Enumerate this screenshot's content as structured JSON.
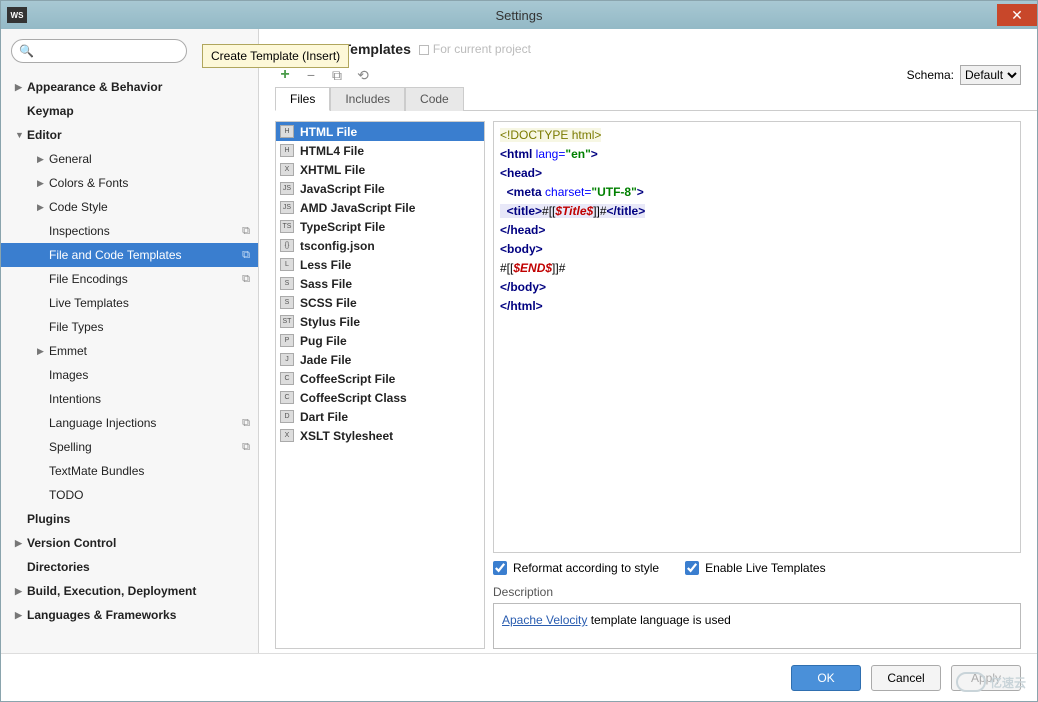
{
  "window": {
    "title": "Settings",
    "app_icon_text": "WS"
  },
  "tooltip": "Create Template (Insert)",
  "search": {
    "placeholder": ""
  },
  "tree": [
    {
      "label": "Appearance & Behavior",
      "level": 1,
      "bold": true,
      "arrow": "▶"
    },
    {
      "label": "Keymap",
      "level": 1,
      "bold": true,
      "arrow": ""
    },
    {
      "label": "Editor",
      "level": 1,
      "bold": true,
      "arrow": "▼"
    },
    {
      "label": "General",
      "level": 2,
      "bold": false,
      "arrow": "▶"
    },
    {
      "label": "Colors & Fonts",
      "level": 2,
      "bold": false,
      "arrow": "▶"
    },
    {
      "label": "Code Style",
      "level": 2,
      "bold": false,
      "arrow": "▶"
    },
    {
      "label": "Inspections",
      "level": 2,
      "bold": false,
      "arrow": "",
      "copy": true
    },
    {
      "label": "File and Code Templates",
      "level": 2,
      "bold": false,
      "arrow": "",
      "sel": true,
      "copy": true
    },
    {
      "label": "File Encodings",
      "level": 2,
      "bold": false,
      "arrow": "",
      "copy": true
    },
    {
      "label": "Live Templates",
      "level": 2,
      "bold": false,
      "arrow": ""
    },
    {
      "label": "File Types",
      "level": 2,
      "bold": false,
      "arrow": ""
    },
    {
      "label": "Emmet",
      "level": 2,
      "bold": false,
      "arrow": "▶"
    },
    {
      "label": "Images",
      "level": 2,
      "bold": false,
      "arrow": ""
    },
    {
      "label": "Intentions",
      "level": 2,
      "bold": false,
      "arrow": ""
    },
    {
      "label": "Language Injections",
      "level": 2,
      "bold": false,
      "arrow": "",
      "copy": true
    },
    {
      "label": "Spelling",
      "level": 2,
      "bold": false,
      "arrow": "",
      "copy": true
    },
    {
      "label": "TextMate Bundles",
      "level": 2,
      "bold": false,
      "arrow": ""
    },
    {
      "label": "TODO",
      "level": 2,
      "bold": false,
      "arrow": ""
    },
    {
      "label": "Plugins",
      "level": 1,
      "bold": true,
      "arrow": ""
    },
    {
      "label": "Version Control",
      "level": 1,
      "bold": true,
      "arrow": "▶"
    },
    {
      "label": "Directories",
      "level": 1,
      "bold": true,
      "arrow": ""
    },
    {
      "label": "Build, Execution, Deployment",
      "level": 1,
      "bold": true,
      "arrow": "▶"
    },
    {
      "label": "Languages & Frameworks",
      "level": 1,
      "bold": true,
      "arrow": "▶"
    }
  ],
  "page_title": "and Code Templates",
  "for_project": "For current project",
  "schema": {
    "label": "Schema:",
    "value": "Default"
  },
  "tabs": [
    "Files",
    "Includes",
    "Code"
  ],
  "active_tab": 0,
  "files": [
    {
      "label": "HTML File",
      "sel": true,
      "ic": "H"
    },
    {
      "label": "HTML4 File",
      "ic": "H"
    },
    {
      "label": "XHTML File",
      "ic": "X"
    },
    {
      "label": "JavaScript File",
      "ic": "JS"
    },
    {
      "label": "AMD JavaScript File",
      "ic": "JS"
    },
    {
      "label": "TypeScript File",
      "ic": "TS"
    },
    {
      "label": "tsconfig.json",
      "ic": "{}"
    },
    {
      "label": "Less File",
      "ic": "L"
    },
    {
      "label": "Sass File",
      "ic": "S"
    },
    {
      "label": "SCSS File",
      "ic": "S"
    },
    {
      "label": "Stylus File",
      "ic": "ST"
    },
    {
      "label": "Pug File",
      "ic": "P"
    },
    {
      "label": "Jade File",
      "ic": "J"
    },
    {
      "label": "CoffeeScript File",
      "ic": "C"
    },
    {
      "label": "CoffeeScript Class",
      "ic": "C"
    },
    {
      "label": "Dart File",
      "ic": "D"
    },
    {
      "label": "XSLT Stylesheet",
      "ic": "X"
    }
  ],
  "checkbox1": "Reformat according to style",
  "checkbox2": "Enable Live Templates",
  "desc_label": "Description",
  "desc_link": "Apache Velocity",
  "desc_rest": " template language is used",
  "buttons": {
    "ok": "OK",
    "cancel": "Cancel",
    "apply": "Apply"
  },
  "watermark": "亿速云",
  "code": {
    "l1a": "<!DOCTYPE ",
    "l1b": "html",
    "l1c": ">",
    "l2a": "<html ",
    "l2b": "lang=",
    "l2c": "\"en\"",
    "l2d": ">",
    "l3": "<head>",
    "l4a": "  <meta ",
    "l4b": "charset=",
    "l4c": "\"UTF-8\"",
    "l4d": ">",
    "l5a": "  <title>",
    "l5b": "#[[",
    "l5c": "$Title$",
    "l5d": "]]#",
    "l5e": "</title>",
    "l6": "</head>",
    "l7": "<body>",
    "l8a": "#[[",
    "l8b": "$END$",
    "l8c": "]]#",
    "l9": "</body>",
    "l10": "</html>"
  }
}
